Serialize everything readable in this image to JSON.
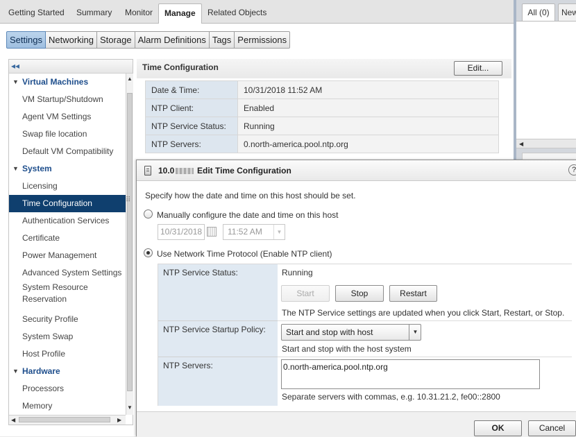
{
  "top_tabs": [
    {
      "label": "Getting Started"
    },
    {
      "label": "Summary"
    },
    {
      "label": "Monitor"
    },
    {
      "label": "Manage"
    },
    {
      "label": "Related Objects"
    }
  ],
  "right_panel": {
    "tab_all": "All (0)",
    "tab_new": "New"
  },
  "sub_tabs": [
    "Settings",
    "Networking",
    "Storage",
    "Alarm Definitions",
    "Tags",
    "Permissions"
  ],
  "nav": {
    "collapse_glyph": "◂◂",
    "items": [
      {
        "label": "Virtual Machines"
      },
      {
        "label": "VM Startup/Shutdown"
      },
      {
        "label": "Agent VM Settings"
      },
      {
        "label": "Swap file location"
      },
      {
        "label": "Default VM Compatibility"
      },
      {
        "label": "System"
      },
      {
        "label": "Licensing"
      },
      {
        "label": "Time Configuration"
      },
      {
        "label": "Authentication Services"
      },
      {
        "label": "Certificate"
      },
      {
        "label": "Power Management"
      },
      {
        "label": "Advanced System Settings"
      },
      {
        "label": "System Resource Reservation"
      },
      {
        "label": "Security Profile"
      },
      {
        "label": "System Swap"
      },
      {
        "label": "Host Profile"
      },
      {
        "label": "Hardware"
      },
      {
        "label": "Processors"
      },
      {
        "label": "Memory"
      }
    ]
  },
  "time_config": {
    "title": "Time Configuration",
    "edit_label": "Edit...",
    "rows": [
      {
        "key": "Date & Time:",
        "value": "10/31/2018 11:52 AM"
      },
      {
        "key": "NTP Client:",
        "value": "Enabled"
      },
      {
        "key": "NTP Service Status:",
        "value": "Running"
      },
      {
        "key": "NTP Servers:",
        "value": "0.north-america.pool.ntp.org"
      }
    ]
  },
  "dialog": {
    "host_prefix": "10.0",
    "title": "Edit Time Configuration",
    "help_glyph": "?",
    "description": "Specify how the date and time on this host should be set.",
    "manual_label": "Manually configure the date and time on this host",
    "date_value": "10/31/2018",
    "time_value": "11:52 AM",
    "ntp_label": "Use Network Time Protocol (Enable NTP client)",
    "status_label": "NTP Service Status:",
    "status_value": "Running",
    "start_label": "Start",
    "stop_label": "Stop",
    "restart_label": "Restart",
    "status_note": "The NTP Service settings are updated when you click Start, Restart, or Stop.",
    "policy_label": "NTP Service Startup Policy:",
    "policy_value": "Start and stop with host",
    "policy_note": "Start and stop with the host system",
    "servers_label": "NTP Servers:",
    "servers_value": "0.north-america.pool.ntp.org",
    "servers_note": "Separate servers with commas, e.g. 10.31.21.2, fe00::2800",
    "ok_label": "OK",
    "cancel_label": "Cancel"
  },
  "colors": {
    "selection": "#0f3f6e",
    "accent": "#1e4e8c"
  }
}
